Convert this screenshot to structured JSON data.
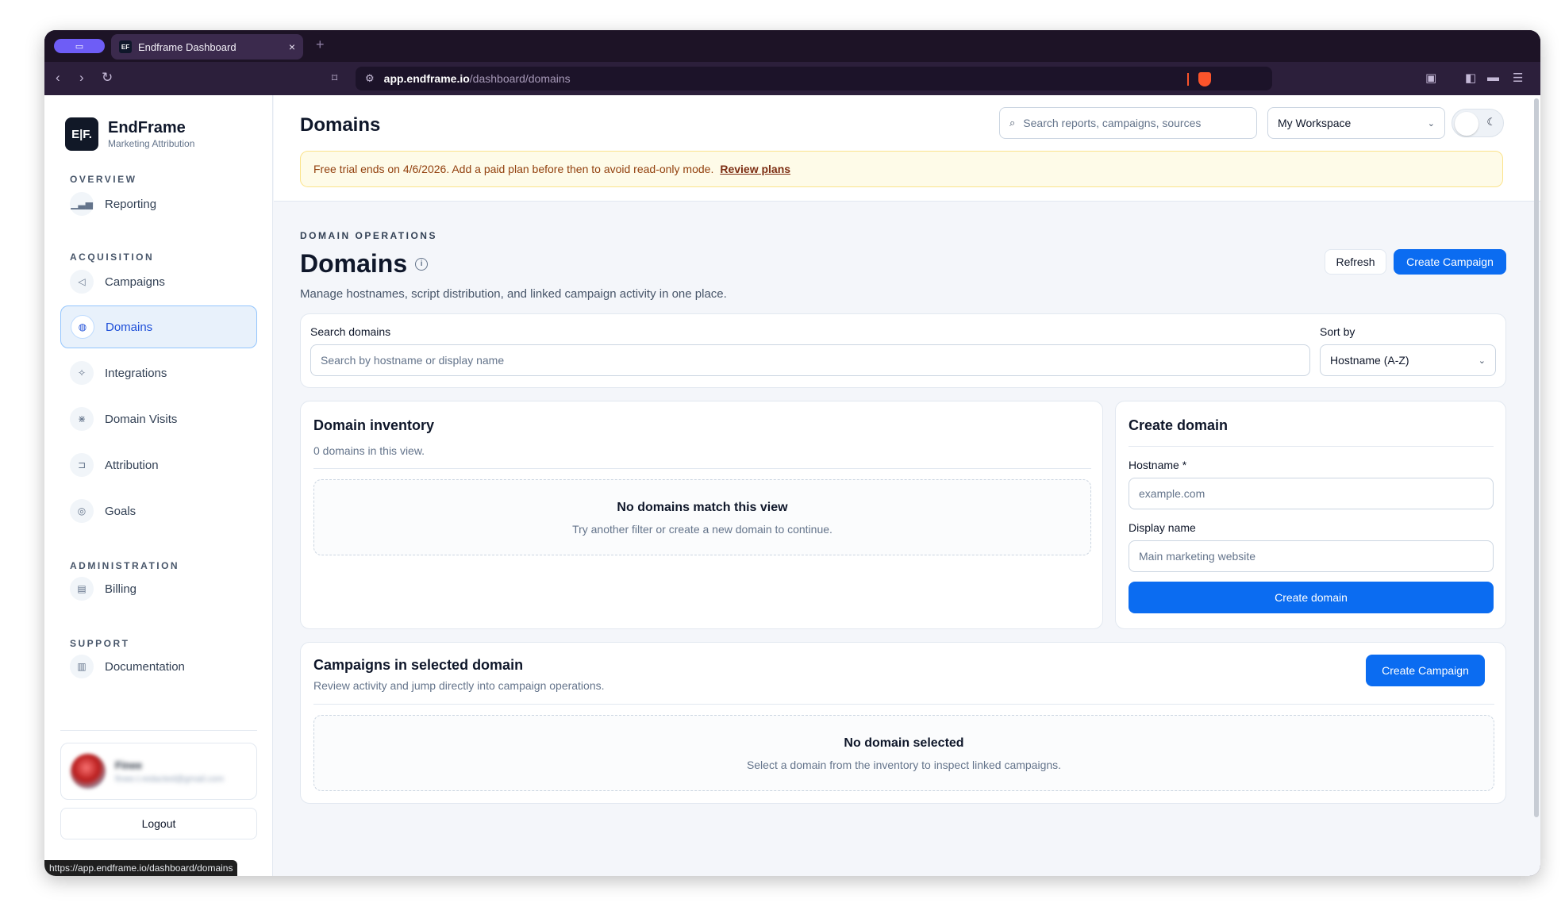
{
  "browser": {
    "tab_title": "Endframe Dashboard",
    "tab_close": "×",
    "new_tab": "+",
    "url_host": "app.endframe.io",
    "url_path": "/dashboard/domains",
    "status_url": "https://app.endframe.io/dashboard/domains"
  },
  "sidebar": {
    "logo_text": "E|F.",
    "brand_name": "EndFrame",
    "brand_sub": "Marketing Attribution",
    "sections": [
      {
        "label": "OVERVIEW"
      },
      {
        "label": "ACQUISITION"
      },
      {
        "label": "ADMINISTRATION"
      },
      {
        "label": "SUPPORT"
      }
    ],
    "items": [
      {
        "label": "Reporting",
        "icon": "bar-chart-icon"
      },
      {
        "label": "Campaigns",
        "icon": "megaphone-icon"
      },
      {
        "label": "Domains",
        "icon": "globe-icon",
        "active": true
      },
      {
        "label": "Integrations",
        "icon": "plug-icon"
      },
      {
        "label": "Domain Visits",
        "icon": "activity-icon"
      },
      {
        "label": "Attribution",
        "icon": "attribution-icon"
      },
      {
        "label": "Goals",
        "icon": "target-icon"
      },
      {
        "label": "Billing",
        "icon": "receipt-icon"
      },
      {
        "label": "Documentation",
        "icon": "document-icon"
      }
    ],
    "user": {
      "name": "Finee",
      "email": "finee.t.redacted@gmail.com"
    },
    "logout_label": "Logout"
  },
  "header": {
    "title": "Domains",
    "search_placeholder": "Search reports, campaigns, sources",
    "workspace": "My Workspace",
    "trial_text": "Free trial ends on 4/6/2026. Add a paid plan before then to avoid read-only mode.",
    "trial_link": "Review plans"
  },
  "main": {
    "eyebrow": "DOMAIN OPERATIONS",
    "title": "Domains",
    "info_glyph": "i",
    "description": "Manage hostnames, script distribution, and linked campaign activity in one place.",
    "refresh_label": "Refresh",
    "create_campaign_label": "Create Campaign",
    "search_label": "Search domains",
    "search_placeholder": "Search by hostname or display name",
    "sort_label": "Sort by",
    "sort_value": "Hostname (A-Z)",
    "inventory": {
      "title": "Domain inventory",
      "count_text": "0 domains in this view.",
      "empty_title": "No domains match this view",
      "empty_sub": "Try another filter or create a new domain to continue."
    },
    "create_domain": {
      "title": "Create domain",
      "hostname_label": "Hostname *",
      "hostname_placeholder": "example.com",
      "display_label": "Display name",
      "display_placeholder": "Main marketing website",
      "submit_label": "Create domain"
    },
    "campaigns": {
      "title": "Campaigns in selected domain",
      "subtitle": "Review activity and jump directly into campaign operations.",
      "button_label": "Create Campaign",
      "empty_title": "No domain selected",
      "empty_sub": "Select a domain from the inventory to inspect linked campaigns."
    }
  },
  "colors": {
    "primary": "#0b6cf1",
    "active_bg": "#e8f1fb",
    "trial_bg": "#fefbe8"
  }
}
